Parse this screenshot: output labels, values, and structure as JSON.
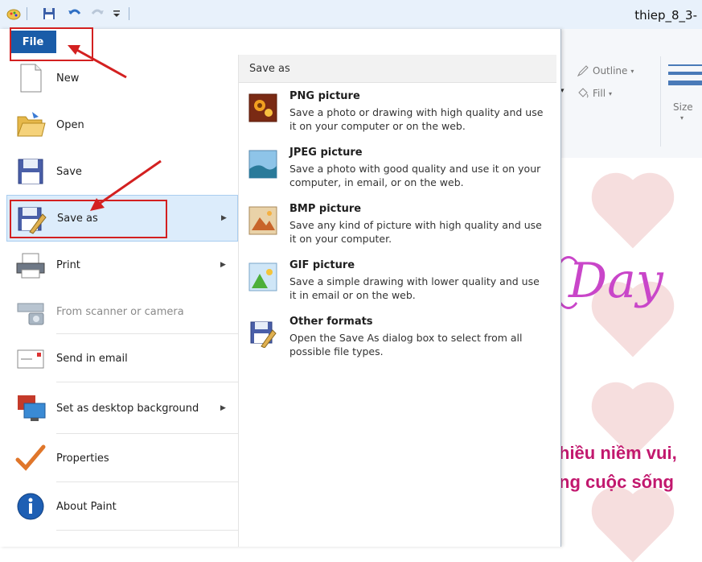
{
  "window": {
    "title": "thiep_8_3-"
  },
  "quick_access": {
    "icons": [
      "paint-app-icon",
      "save-icon",
      "undo-icon",
      "redo-icon",
      "customize-dropdown-icon"
    ]
  },
  "ribbon": {
    "outline_label": "Outline",
    "fill_label": "Fill",
    "size_label": "Size"
  },
  "canvas": {
    "script_text": "Day",
    "line1": "hiều niềm vui,",
    "line2": "ng cuộc sống"
  },
  "file_tab": {
    "label": "File"
  },
  "menu": {
    "items": [
      {
        "label": "New",
        "icon": "new-document-icon",
        "submenu": false,
        "disabled": false
      },
      {
        "label": "Open",
        "icon": "open-folder-icon",
        "submenu": false,
        "disabled": false
      },
      {
        "label": "Save",
        "icon": "save-disk-icon",
        "submenu": false,
        "disabled": false
      },
      {
        "label": "Save as",
        "icon": "save-as-icon",
        "submenu": true,
        "disabled": false,
        "active": true
      },
      {
        "label": "Print",
        "icon": "printer-icon",
        "submenu": true,
        "disabled": false
      },
      {
        "label": "From scanner or camera",
        "icon": "scanner-camera-icon",
        "submenu": false,
        "disabled": true
      },
      {
        "label": "Send in email",
        "icon": "email-icon",
        "submenu": false,
        "disabled": false
      },
      {
        "label": "Set as desktop background",
        "icon": "desktop-background-icon",
        "submenu": true,
        "disabled": false
      },
      {
        "label": "Properties",
        "icon": "checkmark-icon",
        "submenu": false,
        "disabled": false
      },
      {
        "label": "About Paint",
        "icon": "info-icon",
        "submenu": false,
        "disabled": false
      }
    ]
  },
  "save_as_panel": {
    "header": "Save as",
    "options": [
      {
        "title": "PNG picture",
        "desc": "Save a photo or drawing with high quality and use it on your computer or on the web.",
        "icon": "png-picture-icon"
      },
      {
        "title": "JPEG picture",
        "desc": "Save a photo with good quality and use it on your computer, in email, or on the web.",
        "icon": "jpeg-picture-icon"
      },
      {
        "title": "BMP picture",
        "desc": "Save any kind of picture with high quality and use it on your computer.",
        "icon": "bmp-picture-icon"
      },
      {
        "title": "GIF picture",
        "desc": "Save a simple drawing with lower quality and use it in email or on the web.",
        "icon": "gif-picture-icon"
      },
      {
        "title": "Other formats",
        "desc": "Open the Save As dialog box to select from all possible file types.",
        "icon": "other-formats-icon"
      }
    ]
  },
  "colors": {
    "accent": "#1a5ca8",
    "annotation_red": "#d32020",
    "active_item_bg": "#dcecfb"
  }
}
